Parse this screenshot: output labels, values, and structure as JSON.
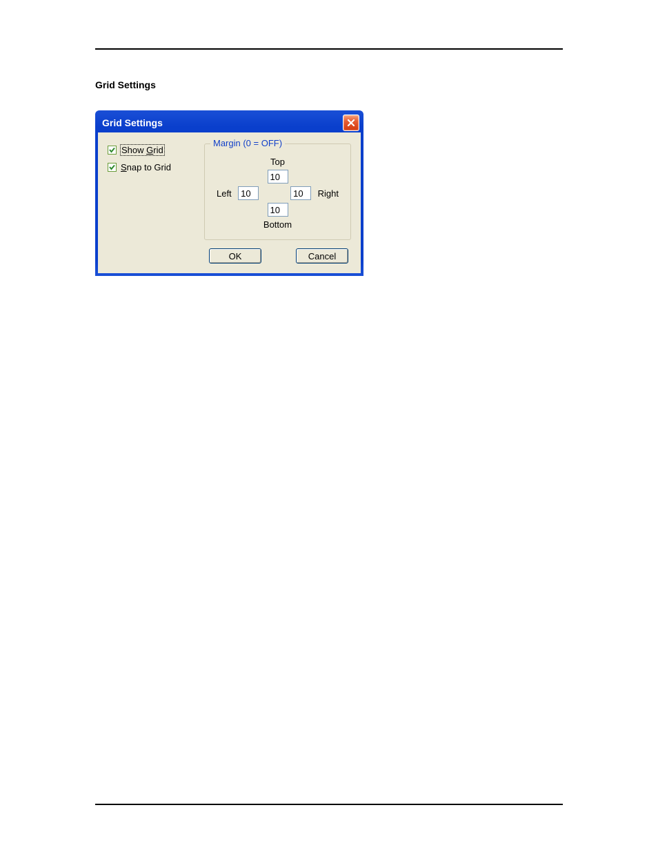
{
  "page": {
    "heading": "Grid Settings"
  },
  "dialog": {
    "title": "Grid Settings",
    "close_icon": "close-icon",
    "checkboxes": {
      "show_grid": {
        "prefix": "Show ",
        "hotkey": "G",
        "suffix": "rid",
        "checked": true
      },
      "snap_to_grid": {
        "hotkey": "S",
        "suffix": "nap to Grid",
        "checked": true
      }
    },
    "margin_group": {
      "legend": "Margin   (0 = OFF)",
      "top_label": "Top",
      "left_label": "Left",
      "right_label": "Right",
      "bottom_label": "Bottom",
      "top_value": "10",
      "left_value": "10",
      "right_value": "10",
      "bottom_value": "10"
    },
    "buttons": {
      "ok": "OK",
      "cancel": "Cancel"
    }
  }
}
